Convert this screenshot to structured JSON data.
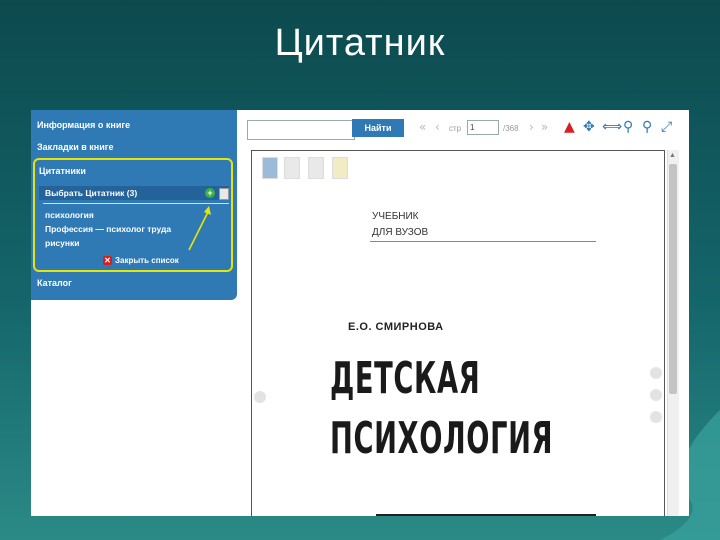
{
  "slide": {
    "title": "Цитатник"
  },
  "sidebar": {
    "book_info": "Информация о книге",
    "bookmarks": "Закладки в книге",
    "quotebooks": "Цитатники",
    "choose_quotebook": "Выбрать Цитатник (3)",
    "items": [
      "психология",
      "Профессия — психолог труда",
      "рисунки"
    ],
    "close_list": "Закрыть список",
    "catalog": "Каталог"
  },
  "toolbar": {
    "search_placeholder": "",
    "find_label": "Найти",
    "page_label": "стр",
    "page_value": "1",
    "page_total": "/368"
  },
  "book": {
    "subtitle_line1": "УЧЕБНИК",
    "subtitle_line2": "ДЛЯ ВУЗОВ",
    "author": "Е.О. СМИРНОВА",
    "title_line1": "ДЕТСКАЯ",
    "title_line2": "ПСИХОЛОГИЯ"
  },
  "colors": {
    "sidebar": "#2f79b5",
    "highlight": "#e6e600",
    "accent_red": "#d62020"
  }
}
